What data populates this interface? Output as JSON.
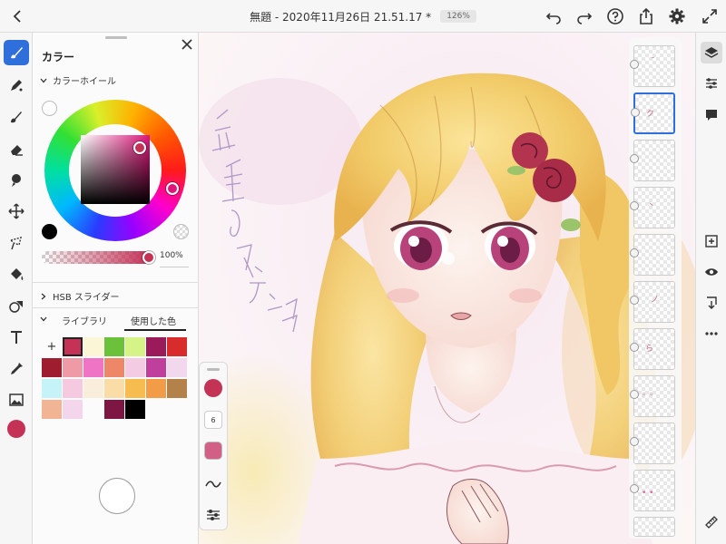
{
  "topbar": {
    "title": "無題 - 2020年11月26日 21.51.17 *",
    "zoom": "126%"
  },
  "color_panel": {
    "title": "カラー",
    "wheel_section": "カラーホイール",
    "hsb_section": "HSB スライダー",
    "opacity": "100%",
    "tabs": {
      "library": "ライブラリ",
      "used": "使用した色"
    },
    "add_label": "+",
    "current_color": "#c43256",
    "swatches": [
      "#c43256",
      "#fbf7d6",
      "#6cc13a",
      "#d6f387",
      "#9b1a5a",
      "#d82c2c",
      "#9e1d2f",
      "#ef9aa7",
      "#ef74c5",
      "#ee8668",
      "#f3cbe3",
      "#c03e9c",
      "#f1d8ec",
      "#c6f3f8",
      "#f5c9e0",
      "#f9eedc",
      "#fadca7",
      "#f6bc4f",
      "#f39c47",
      "#b3824a",
      "#f1b494",
      "#f3d6ec",
      "#ffffff",
      "#7e1644",
      "#000000"
    ]
  },
  "brush_bar": {
    "size": "6",
    "color": "#c43256"
  },
  "canvas": {
    "handwriting": [
      "完",
      "全",
      "に",
      "ス",
      "ラ",
      "ン",
      "プ"
    ]
  }
}
